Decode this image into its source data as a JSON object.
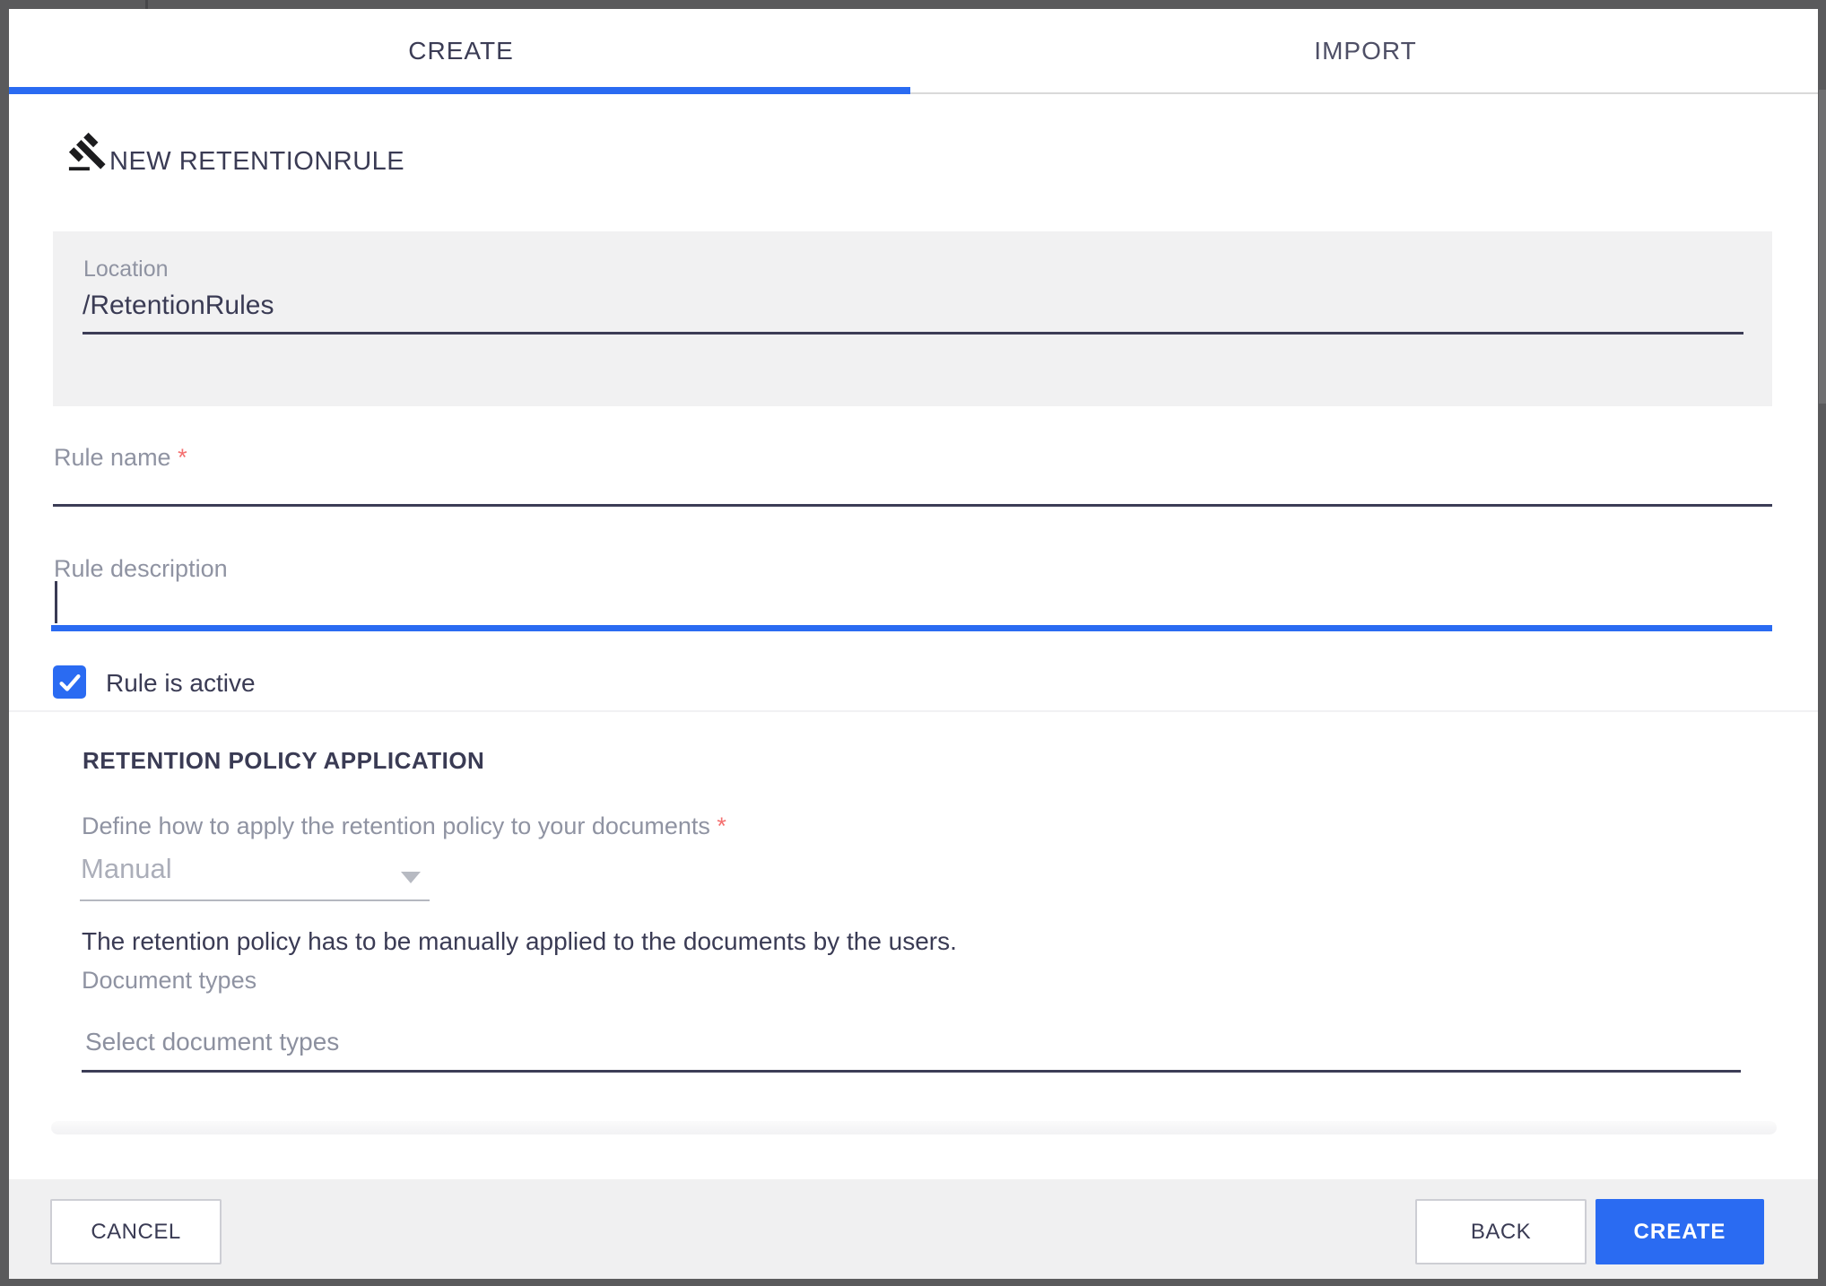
{
  "tabs": [
    {
      "id": "create",
      "label": "CREATE",
      "active": true
    },
    {
      "id": "import",
      "label": "IMPORT",
      "active": false
    }
  ],
  "header": {
    "title": "NEW RETENTIONRULE"
  },
  "form": {
    "location": {
      "label": "Location",
      "value": "/RetentionRules"
    },
    "rule_name": {
      "label": "Rule name",
      "required": "*",
      "value": ""
    },
    "rule_description": {
      "label": "Rule description",
      "value": ""
    },
    "rule_active": {
      "label": "Rule is active",
      "checked": true
    },
    "retention_policy": {
      "section_title": "RETENTION POLICY APPLICATION",
      "apply_label": "Define how to apply the retention policy to your documents",
      "apply_required": "*",
      "apply_value": "Manual",
      "apply_helper": "The retention policy has to be manually applied to the documents by the users.",
      "document_types_label": "Document types",
      "document_types_placeholder": "Select document types"
    }
  },
  "footer": {
    "cancel_label": "CANCEL",
    "back_label": "BACK",
    "create_label": "CREATE"
  },
  "colors": {
    "primary_blue": "#2a6bf2",
    "dark_text": "#3a3b54",
    "label_grey": "#8f93a2",
    "required_red": "#f47070",
    "panel_grey": "#f1f1f2",
    "footer_grey": "#f0f0f1",
    "frame_grey": "#5a5a5c"
  }
}
